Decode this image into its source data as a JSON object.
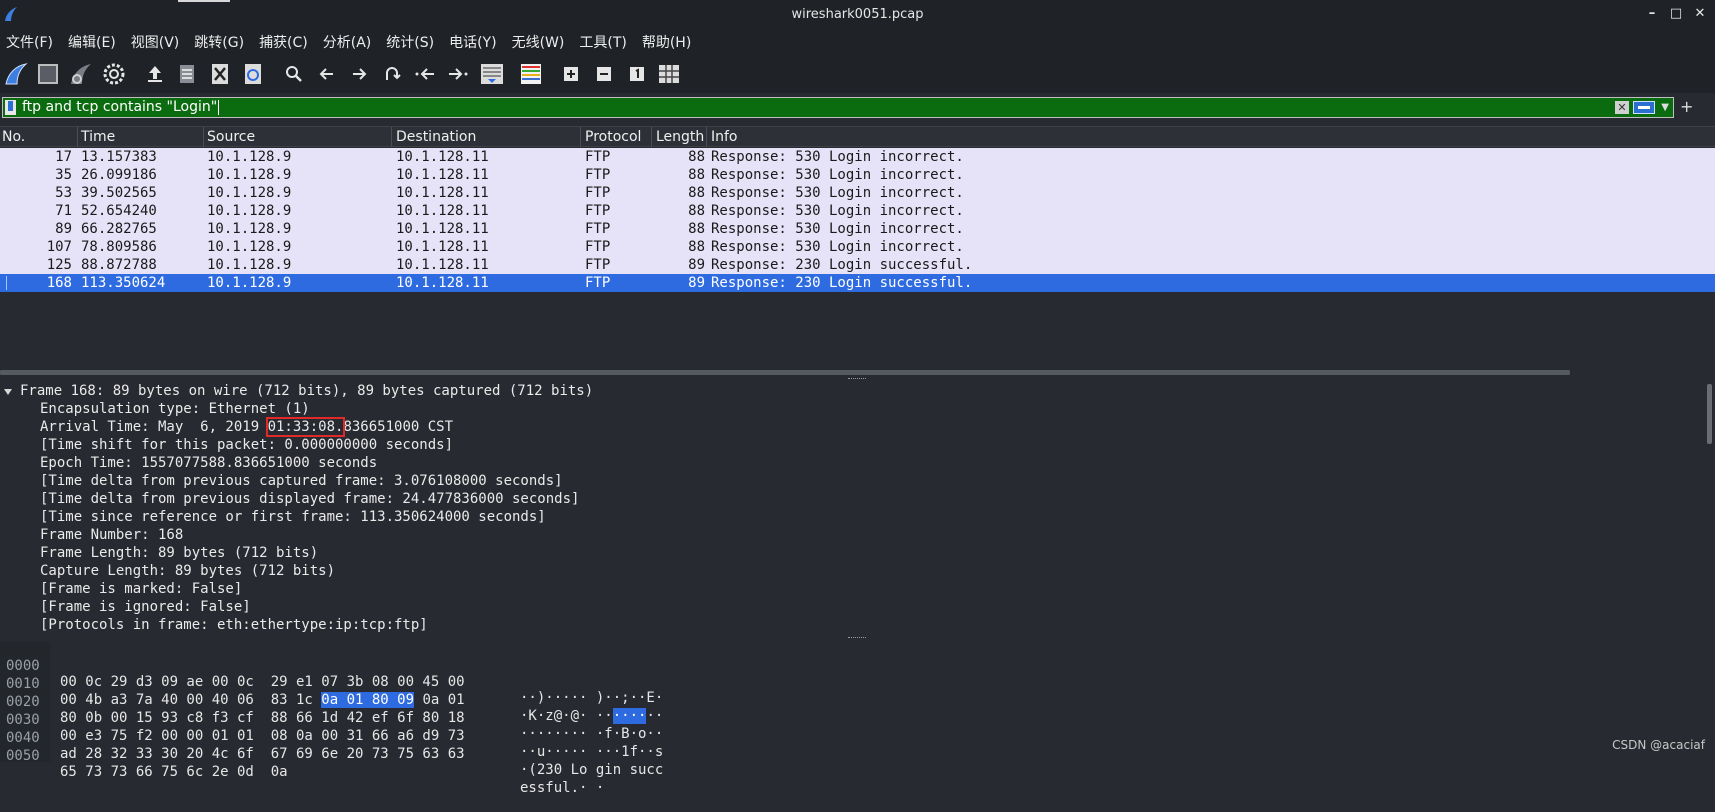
{
  "window": {
    "title": "wireshark0051.pcap",
    "minimize": "–",
    "maximize": "□",
    "close": "✕"
  },
  "menu": [
    "文件(F)",
    "编辑(E)",
    "视图(V)",
    "跳转(G)",
    "捕获(C)",
    "分析(A)",
    "统计(S)",
    "电话(Y)",
    "无线(W)",
    "工具(T)",
    "帮助(H)"
  ],
  "toolbar": {
    "icons": [
      "shark-start-icon",
      "stop-icon",
      "restart-icon",
      "options-gear-icon",
      "open-file-icon",
      "save-file-icon",
      "close-file-icon",
      "reload-icon",
      "search-icon",
      "back-arrow-icon",
      "forward-arrow-icon",
      "goto-packet-icon",
      "first-packet-icon",
      "last-packet-icon",
      "autoscroll-icon",
      "colorize-icon",
      "zoom-in-icon",
      "zoom-out-icon",
      "normal-size-icon",
      "resize-columns-icon"
    ]
  },
  "filter": {
    "value": "ftp and  tcp contains \"Login\"",
    "clear_icon": "x-icon",
    "apply_icon": "arrow-right-icon",
    "dropdown_icon": "chevron-down-icon",
    "add_button": "+"
  },
  "packet_list": {
    "columns": [
      "No.",
      "Time",
      "Source",
      "Destination",
      "Protocol",
      "Length",
      "Info"
    ],
    "rows": [
      {
        "no": "17",
        "time": "13.157383",
        "src": "10.1.128.9",
        "dst": "10.1.128.11",
        "proto": "FTP",
        "len": "88",
        "info": "Response: 530 Login incorrect."
      },
      {
        "no": "35",
        "time": "26.099186",
        "src": "10.1.128.9",
        "dst": "10.1.128.11",
        "proto": "FTP",
        "len": "88",
        "info": "Response: 530 Login incorrect."
      },
      {
        "no": "53",
        "time": "39.502565",
        "src": "10.1.128.9",
        "dst": "10.1.128.11",
        "proto": "FTP",
        "len": "88",
        "info": "Response: 530 Login incorrect."
      },
      {
        "no": "71",
        "time": "52.654240",
        "src": "10.1.128.9",
        "dst": "10.1.128.11",
        "proto": "FTP",
        "len": "88",
        "info": "Response: 530 Login incorrect."
      },
      {
        "no": "89",
        "time": "66.282765",
        "src": "10.1.128.9",
        "dst": "10.1.128.11",
        "proto": "FTP",
        "len": "88",
        "info": "Response: 530 Login incorrect."
      },
      {
        "no": "107",
        "time": "78.809586",
        "src": "10.1.128.9",
        "dst": "10.1.128.11",
        "proto": "FTP",
        "len": "88",
        "info": "Response: 530 Login incorrect."
      },
      {
        "no": "125",
        "time": "88.872788",
        "src": "10.1.128.9",
        "dst": "10.1.128.11",
        "proto": "FTP",
        "len": "89",
        "info": "Response: 230 Login successful."
      },
      {
        "no": "168",
        "time": "113.350624",
        "src": "10.1.128.9",
        "dst": "10.1.128.11",
        "proto": "FTP",
        "len": "89",
        "info": "Response: 230 Login successful.",
        "selected": true
      }
    ]
  },
  "details": {
    "frame": "Frame 168: 89 bytes on wire (712 bits), 89 bytes captured (712 bits)",
    "encapsulation": "Encapsulation type: Ethernet (1)",
    "arrival_prefix": "Arrival Time: May  6, 2019 ",
    "arrival_highlight": "01:33:08.",
    "arrival_suffix": "836651000 CST",
    "lines": [
      "[Time shift for this packet: 0.000000000 seconds]",
      "Epoch Time: 1557077588.836651000 seconds",
      "[Time delta from previous captured frame: 3.076108000 seconds]",
      "[Time delta from previous displayed frame: 24.477836000 seconds]",
      "[Time since reference or first frame: 113.350624000 seconds]",
      "Frame Number: 168",
      "Frame Length: 89 bytes (712 bits)",
      "Capture Length: 89 bytes (712 bits)",
      "[Frame is marked: False]",
      "[Frame is ignored: False]",
      "[Protocols in frame: eth:ethertype:ip:tcp:ftp]"
    ]
  },
  "bytes": [
    {
      "off": "0000",
      "hex": "00 0c 29 d3 09 ae 00 0c  29 e1 07 3b 08 00 45 00",
      "asc": "··)····· )··;··E·"
    },
    {
      "off": "0010",
      "hex_a": "00 4b a3 7a 40 00 40 06  83 1c ",
      "hex_hl": "0a 01 80 09",
      "hex_b": " 0a 01",
      "asc_a": "·K·z@·@· ··",
      "asc_hl": "····",
      "asc_b": "··"
    },
    {
      "off": "0020",
      "hex": "80 0b 00 15 93 c8 f3 cf  88 66 1d 42 ef 6f 80 18",
      "asc": "········ ·f·B·o··"
    },
    {
      "off": "0030",
      "hex": "00 e3 75 f2 00 00 01 01  08 0a 00 31 66 a6 d9 73",
      "asc": "··u····· ···1f··s"
    },
    {
      "off": "0040",
      "hex": "ad 28 32 33 30 20 4c 6f  67 69 6e 20 73 75 63 63",
      "asc": "·(230 Lo gin succ"
    },
    {
      "off": "0050",
      "hex": "65 73 73 66 75 6c 2e 0d  0a",
      "asc": "essful.· ·"
    }
  ],
  "watermark": "CSDN @acaciaf",
  "colors": {
    "accent": "#2f6be0",
    "filter_ok": "#0b6b0f",
    "row_bg": "#e6e3f8",
    "highlight_box": "#e02a2a"
  }
}
